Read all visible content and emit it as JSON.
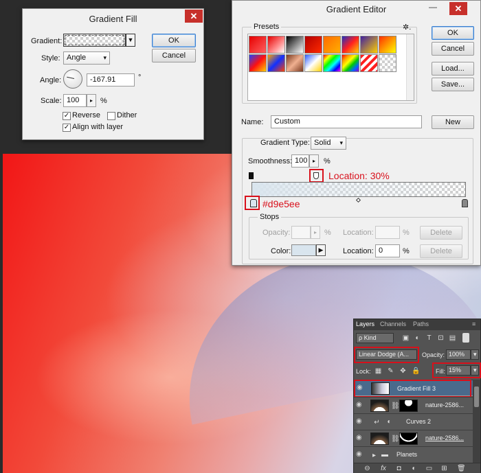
{
  "gradient_fill": {
    "title": "Gradient Fill",
    "close": "✕",
    "gradient_label": "Gradient:",
    "style_label": "Style:",
    "style_value": "Angle",
    "angle_label": "Angle:",
    "angle_value": "-167.91",
    "degree": "°",
    "scale_label": "Scale:",
    "scale_value": "100",
    "percent": "%",
    "reverse_label": "Reverse",
    "reverse_checked": true,
    "dither_label": "Dither",
    "dither_checked": false,
    "align_label": "Align with layer",
    "align_checked": true,
    "ok": "OK",
    "cancel": "Cancel"
  },
  "gradient_editor": {
    "title": "Gradient Editor",
    "minimize": "—",
    "close": "✕",
    "presets_label": "Presets",
    "gear": "✲.",
    "ok": "OK",
    "cancel": "Cancel",
    "load": "Load...",
    "save": "Save...",
    "name_label": "Name:",
    "name_value": "Custom",
    "new": "New",
    "type_label": "Gradient Type:",
    "type_value": "Solid",
    "smoothness_label": "Smoothness:",
    "smoothness_value": "100",
    "percent": "%",
    "stops_label": "Stops",
    "opacity_label": "Opacity:",
    "location_label": "Location:",
    "delete": "Delete",
    "color_label": "Color:",
    "color_swatch": "#d9e5ee",
    "location_value": "0",
    "annotation_location": "Location: 30%",
    "annotation_color": "#d9e5ee"
  },
  "presets": [
    "linear-gradient(135deg,#e60000,#ff6060)",
    "linear-gradient(135deg,#e60000 0%,#ff9090 60%,#ffffff 100%)",
    "linear-gradient(135deg,#000,#fff)",
    "linear-gradient(135deg,#b30000,#ff2a00)",
    "linear-gradient(135deg,#ff6a00,#ffb000)",
    "linear-gradient(135deg,#2030c0,#ff2020,#ffd000)",
    "linear-gradient(135deg,#4020a0,#ffd000)",
    "linear-gradient(135deg,#ff3000,#ffff00)",
    "linear-gradient(135deg,#2040ff,#ff1010,#ffd000)",
    "linear-gradient(135deg,#ffa000,#1030ff,#ff4000)",
    "linear-gradient(135deg,#7a3a20,#f0b090,#7a3a20)",
    "linear-gradient(135deg,#3060ff,#ffffff,#ffd000)",
    "linear-gradient(135deg,#ff0000,#ffff00,#00ff00,#00ffff,#0000ff,#ff00ff)",
    "linear-gradient(135deg,#ff0000,#ff9900,#ffff00,#00cc00,#0066ff,#9900cc)",
    "repeating-linear-gradient(135deg,#ff2020 0 4px,#ffffff 4px 8px)",
    "checker"
  ],
  "layers": {
    "tab_layers": "Layers",
    "tab_channels": "Channels",
    "tab_paths": "Paths",
    "menu": "≡",
    "kind": "ρ Kind",
    "blend_mode": "Linear Dodge (A...",
    "opacity_label": "Opacity:",
    "opacity_value": "100%",
    "lock_label": "Lock:",
    "fill_label": "Fill:",
    "fill_value": "15%",
    "rows": [
      {
        "name": "Gradient Fill 3",
        "selected": true
      },
      {
        "name": "nature-2586...",
        "selected": false
      },
      {
        "name": "Curves 2",
        "selected": false
      },
      {
        "name": "nature-2586...",
        "selected": false
      },
      {
        "name": "Planets",
        "selected": false
      }
    ],
    "footer_icons": [
      "link-icon",
      "fx-icon",
      "mask-icon",
      "adjustment-icon",
      "folder-icon",
      "new-layer-icon",
      "trash-icon"
    ],
    "footer_glyphs": [
      "⊖",
      "fx",
      "◘",
      "◐",
      "▭",
      "⊞",
      "🗑"
    ]
  }
}
